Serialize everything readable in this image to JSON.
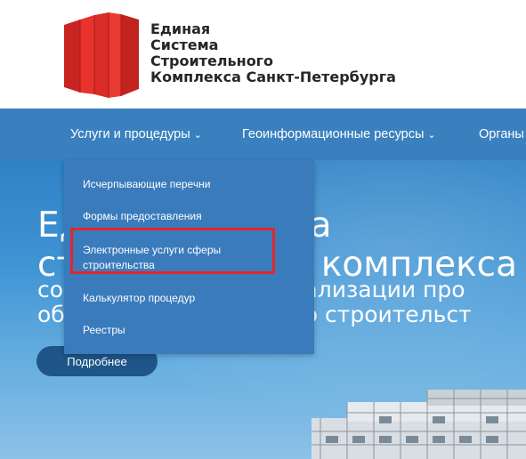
{
  "header": {
    "logo_lines": [
      "Единая",
      "Система",
      "Строительного",
      "Комплекса Санкт-Петербурга"
    ],
    "logo_color": "#e8322b"
  },
  "nav": {
    "items": [
      {
        "label": "Услуги и процедуры",
        "chevron": "chevron-down-icon"
      },
      {
        "label": "Геоинформационные ресурсы",
        "chevron": "chevron-down-icon"
      },
      {
        "label": "Органы"
      }
    ],
    "background": "#3a80bf"
  },
  "hero": {
    "title_lines": [
      "Единая система",
      "строительного комплекса –"
    ],
    "subtitle_lines": [
      "сокращение сроков реализации про",
      "объектов капитального строительст"
    ],
    "button_label": "Подробнее"
  },
  "dropdown": {
    "items": [
      {
        "lines": [
          "Исчерпывающие перечни"
        ]
      },
      {
        "lines": [
          "Формы предоставления"
        ]
      },
      {
        "lines": [
          "Электронные услуги сферы",
          "строительства"
        ],
        "highlighted": true
      },
      {
        "lines": [
          "Калькулятор процедур"
        ]
      },
      {
        "lines": [
          "Реестры"
        ]
      }
    ],
    "highlight_color": "#e3262b"
  }
}
